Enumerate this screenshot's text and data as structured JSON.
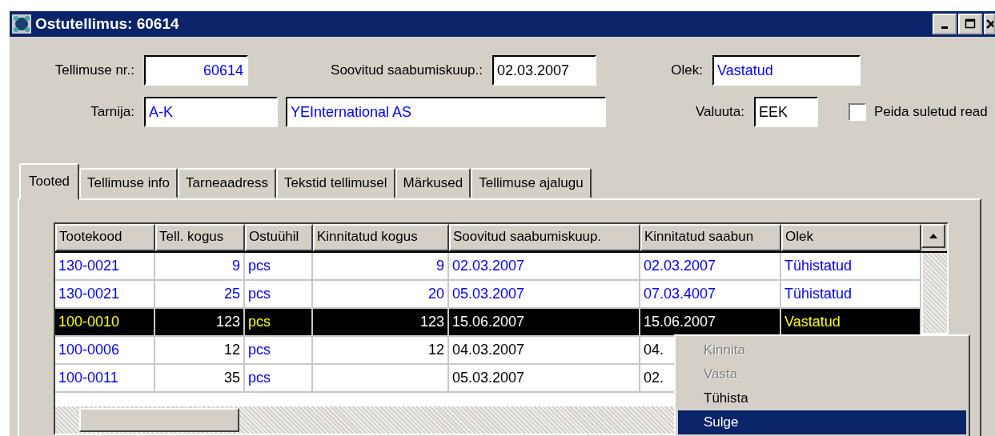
{
  "window": {
    "title": "Ostutellimus: 60614"
  },
  "form": {
    "order_no": {
      "label": "Tellimuse nr.:",
      "value": "60614"
    },
    "desired_date": {
      "label": "Soovitud saabumiskuup.:",
      "value": "02.03.2007"
    },
    "status": {
      "label": "Olek:",
      "value": "Vastatud"
    },
    "supplier": {
      "label": "Tarnija:",
      "code": "A-K",
      "name": "YEInternational AS"
    },
    "currency": {
      "label": "Valuuta:",
      "value": "EEK"
    },
    "hide_closed": {
      "label": "Peida suletud read",
      "checked": false
    }
  },
  "tabs": [
    {
      "label": "Tooted",
      "selected": true
    },
    {
      "label": "Tellimuse info",
      "selected": false
    },
    {
      "label": "Tarneaadress",
      "selected": false
    },
    {
      "label": "Tekstid tellimusel",
      "selected": false
    },
    {
      "label": "Märkused",
      "selected": false
    },
    {
      "label": "Tellimuse ajalugu",
      "selected": false
    }
  ],
  "table": {
    "columns": [
      {
        "label": "Tootekood",
        "kind": "text"
      },
      {
        "label": "Tell. kogus",
        "kind": "number"
      },
      {
        "label": "Ostuühil",
        "kind": "text"
      },
      {
        "label": "Kinnitatud kogus",
        "kind": "number"
      },
      {
        "label": "Soovitud saabumiskuup.",
        "kind": "date"
      },
      {
        "label": "Kinnitatud saabun",
        "kind": "date"
      },
      {
        "label": "Olek",
        "kind": "text"
      }
    ],
    "rows": [
      {
        "kind": "cancelled",
        "selected": false,
        "cells": [
          "130-0021",
          "9",
          "pcs",
          "9",
          "02.03.2007",
          "02.03.2007",
          "Tühistatud"
        ]
      },
      {
        "kind": "cancelled",
        "selected": false,
        "cells": [
          "130-0021",
          "25",
          "pcs",
          "20",
          "05.03.2007",
          "07.03.4007",
          "Tühistatud"
        ]
      },
      {
        "kind": "open",
        "selected": true,
        "cells": [
          "100-0010",
          "123",
          "pcs",
          "123",
          "15.06.2007",
          "15.06.2007",
          "Vastatud"
        ]
      },
      {
        "kind": "open",
        "selected": false,
        "cells": [
          "100-0006",
          "12",
          "pcs",
          "12",
          "04.03.2007",
          "04."
        ]
      },
      {
        "kind": "open",
        "selected": false,
        "cells": [
          "100-0011",
          "35",
          "pcs",
          "",
          "05.03.2007",
          "02."
        ]
      }
    ]
  },
  "context_menu": [
    {
      "label": "Kinnita",
      "disabled": true,
      "selected": false
    },
    {
      "label": "Vasta",
      "disabled": true,
      "selected": false
    },
    {
      "label": "Tühista",
      "disabled": false,
      "selected": false
    },
    {
      "label": "Sulge",
      "disabled": false,
      "selected": true
    }
  ]
}
